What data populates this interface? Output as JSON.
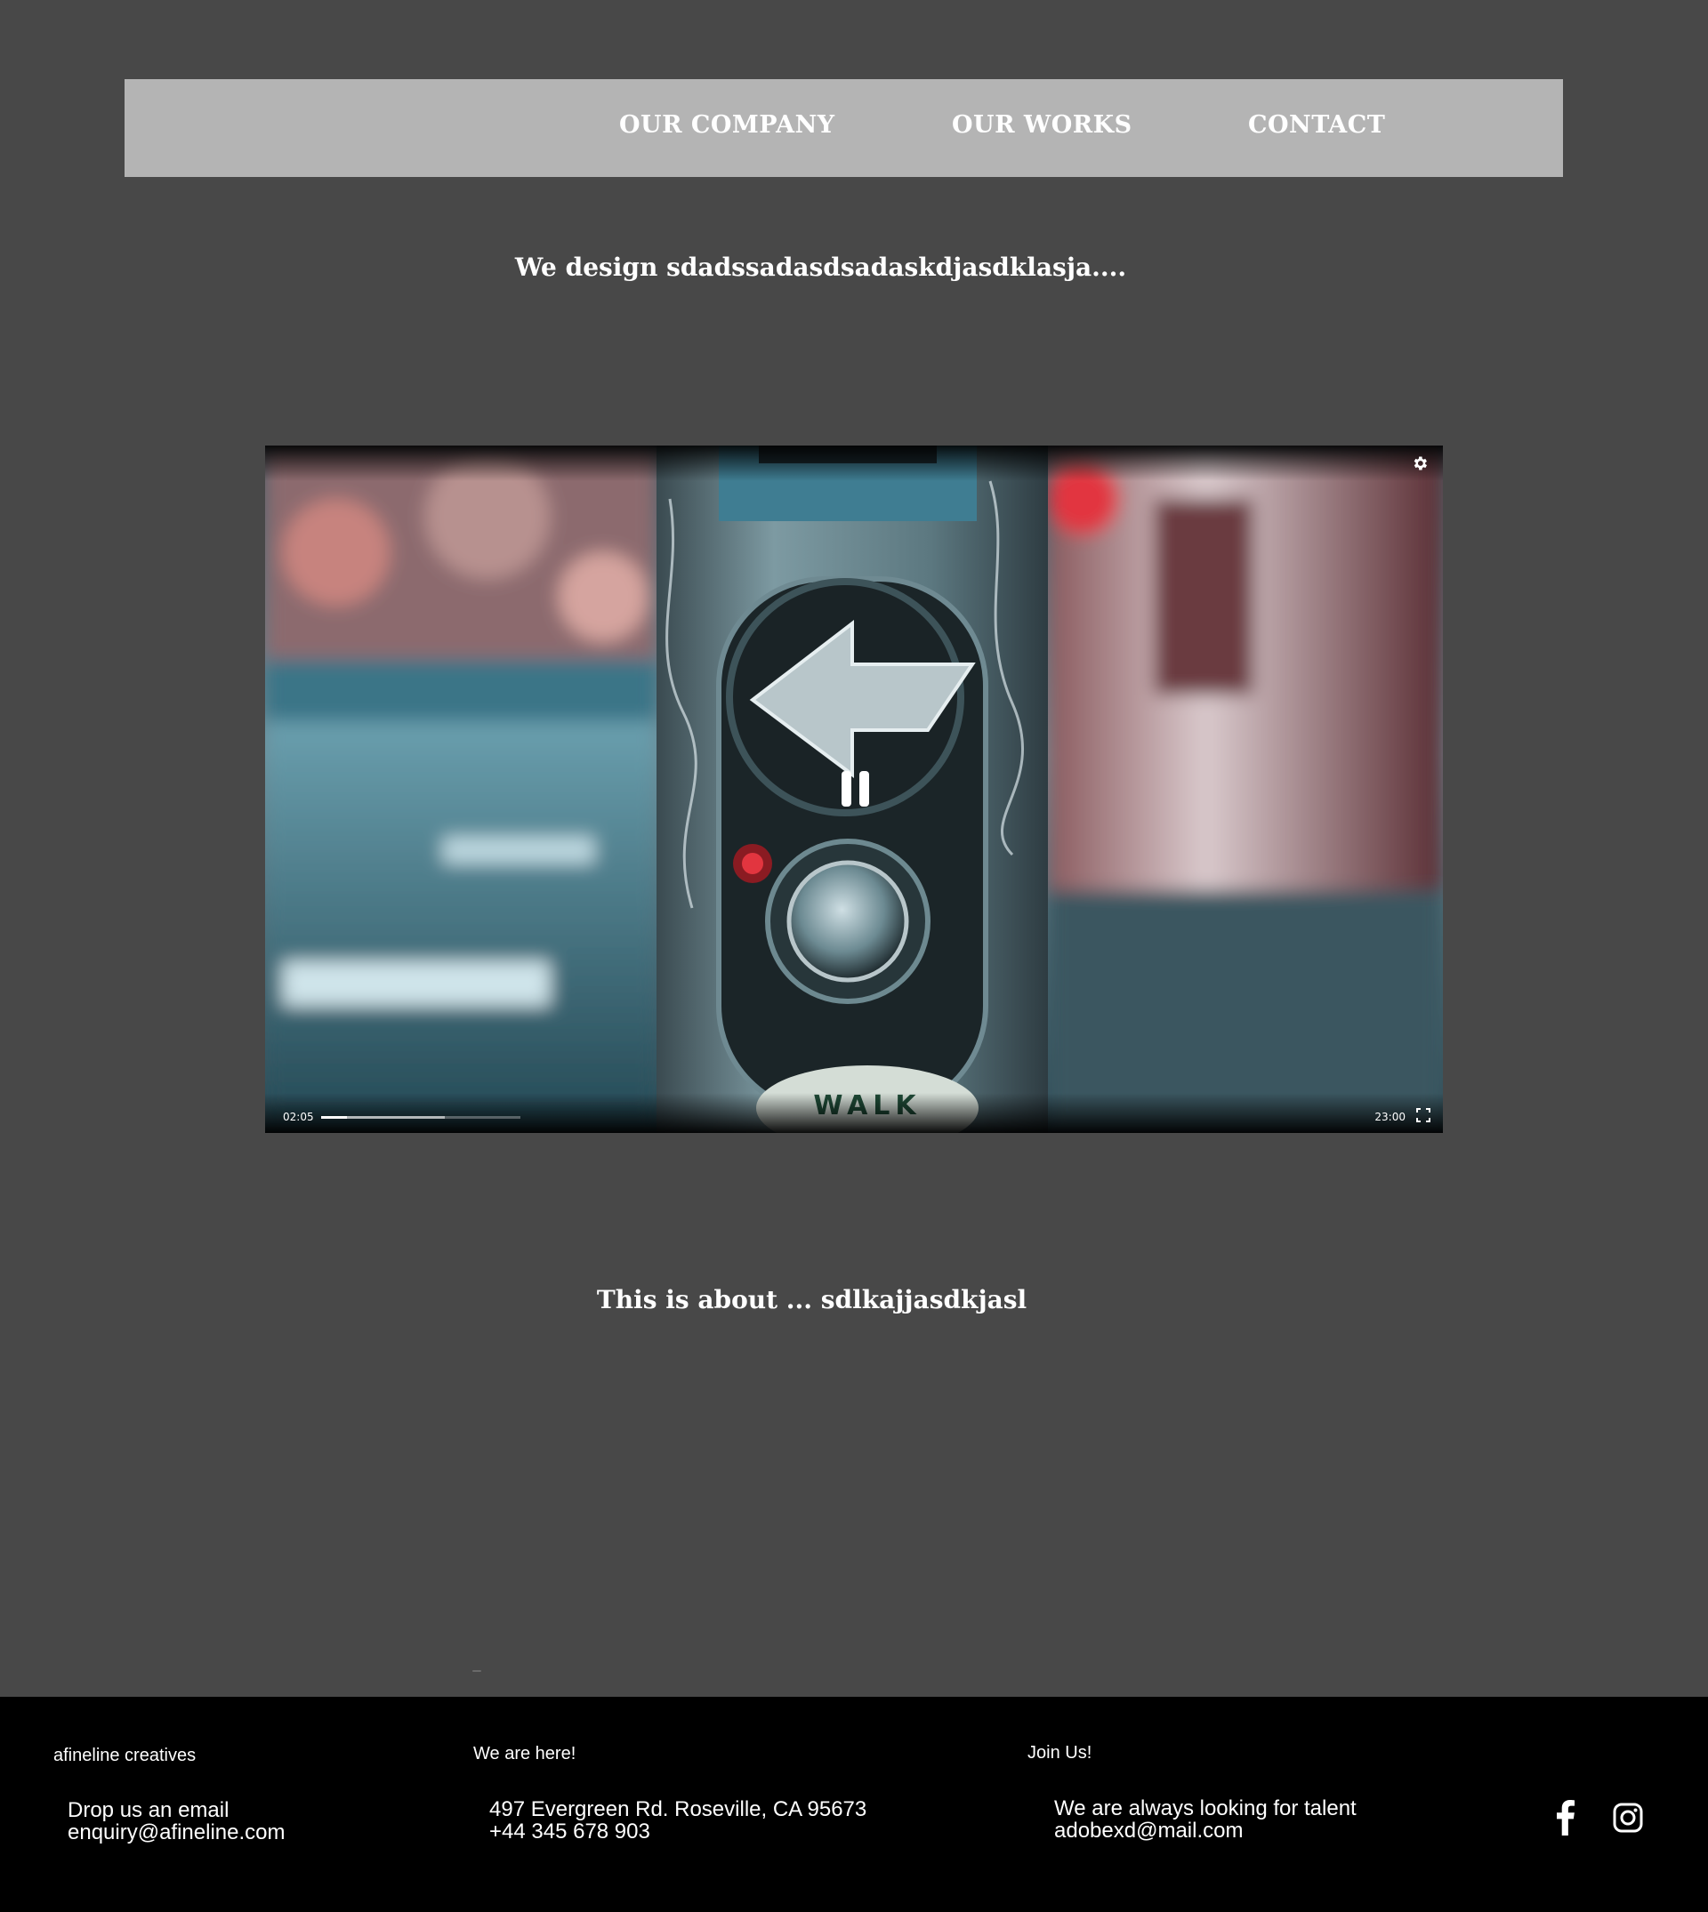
{
  "nav": {
    "items": [
      {
        "label": "OUR COMPANY"
      },
      {
        "label": "OUR WORKS"
      },
      {
        "label": "CONTACT"
      }
    ]
  },
  "hero": {
    "tagline": "We design sdadssadasdsadaskdjasdklasja...."
  },
  "video": {
    "current_time": "02:05",
    "total_time": "23:00",
    "played_fraction": 0.13,
    "buffered_fraction": 0.62,
    "state": "playing",
    "poster_text": "WALK"
  },
  "about": {
    "heading": "This is about ... sdlkajjasdkjasl"
  },
  "footer": {
    "col1": {
      "heading": "afineline creatives",
      "line1": "Drop us an email",
      "line2": "enquiry@afineline.com"
    },
    "col2": {
      "heading": "We are here!",
      "line1": "497 Evergreen Rd. Roseville, CA 95673",
      "line2": "+44 345 678 903"
    },
    "col3": {
      "heading": "Join Us!",
      "line1": "We are always looking for talent",
      "line2": "adobexd@mail.com"
    },
    "social": [
      "facebook-icon",
      "instagram-icon"
    ]
  },
  "colors": {
    "page_bg": "#484848",
    "nav_bg": "#b4b4b4",
    "footer_bg": "#000000",
    "text": "#ffffff"
  }
}
